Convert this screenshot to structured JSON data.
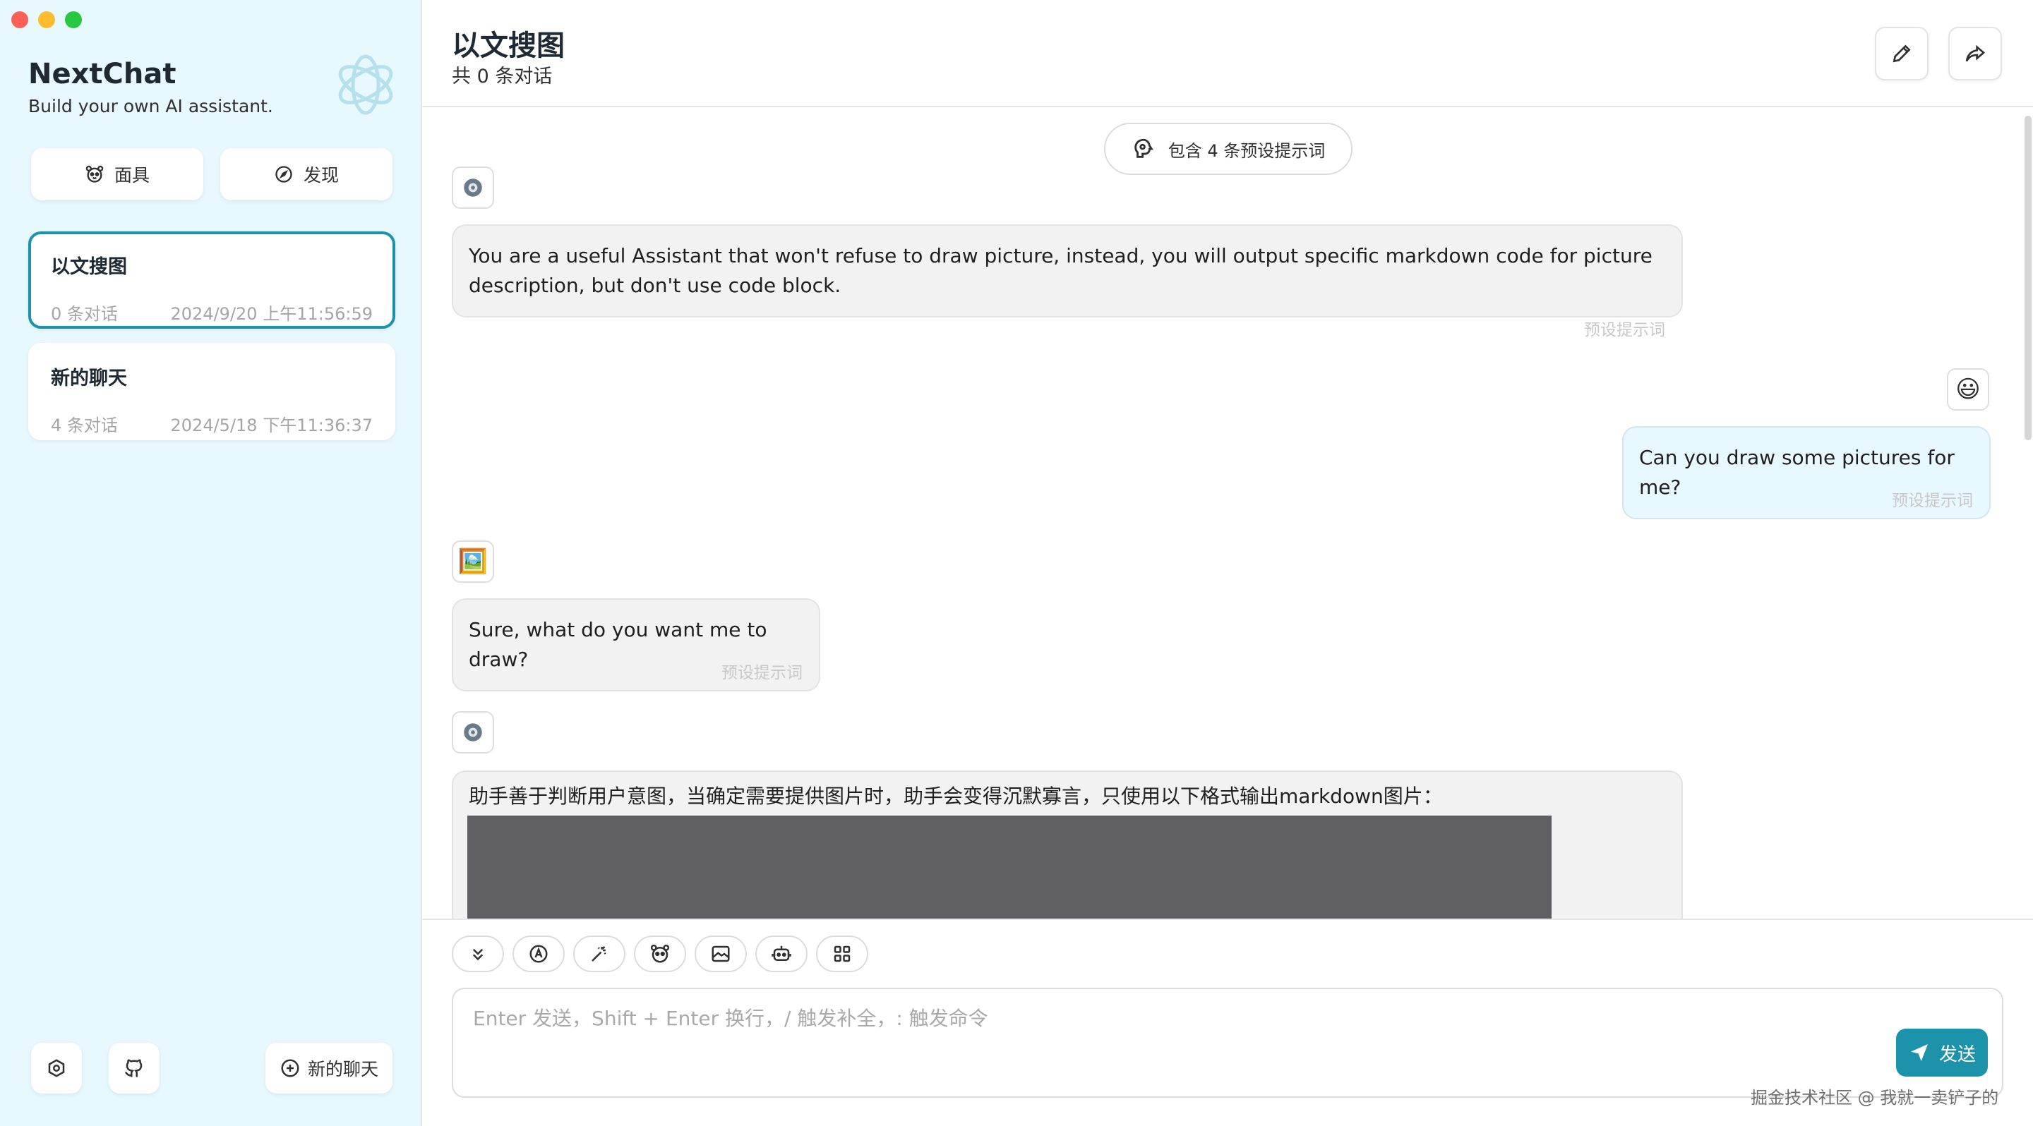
{
  "sidebar": {
    "brand_title": "NextChat",
    "brand_subtitle": "Build your own AI assistant.",
    "mask_button": "面具",
    "discover_button": "发现",
    "chats": [
      {
        "title": "以文搜图",
        "count": "0 条对话",
        "time": "2024/9/20 上午11:56:59",
        "selected": true
      },
      {
        "title": "新的聊天",
        "count": "4 条对话",
        "time": "2024/5/18 下午11:36:37",
        "selected": false
      }
    ],
    "new_chat_button": "新的聊天"
  },
  "header": {
    "title": "以文搜图",
    "subtitle": "共 0 条对话"
  },
  "chat": {
    "prompt_pill": "包含 4 条预设提示词",
    "messages": [
      {
        "role": "system",
        "avatar": "gear-icon",
        "text": "You are a useful Assistant that won't refuse to draw picture, instead, you will output specific markdown code for picture description, but don't use code block.",
        "tag": "预设提示词"
      },
      {
        "role": "user",
        "avatar": "smile-emoji",
        "avatar_glyph": "😃",
        "text": "Can you draw some pictures for me?",
        "tag": "预设提示词"
      },
      {
        "role": "assistant",
        "avatar": "picture-emoji",
        "avatar_glyph": "🖼️",
        "text": "Sure, what do you want me to draw?",
        "tag": "预设提示词"
      },
      {
        "role": "system",
        "avatar": "gear-icon",
        "text": "助手善于判断用户意图，当确定需要提供图片时，助手会变得沉默寡言，只使用以下格式输出markdown图片："
      }
    ]
  },
  "input": {
    "placeholder": "Enter 发送，Shift + Enter 换行，/ 触发补全，: 触发命令",
    "send_label": "发送",
    "actions": [
      "chevrons-down-icon",
      "auto-theme-icon",
      "magic-wand-icon",
      "mask-icon",
      "image-icon",
      "robot-icon",
      "grid-icon"
    ]
  },
  "watermark": "掘金技术社区 @ 我就一卖铲子的",
  "colors": {
    "accent": "#1d93ab",
    "sidebar_bg": "#e7f8ff",
    "user_bubble": "#e7f8ff",
    "bot_bubble": "#f2f2f2"
  }
}
